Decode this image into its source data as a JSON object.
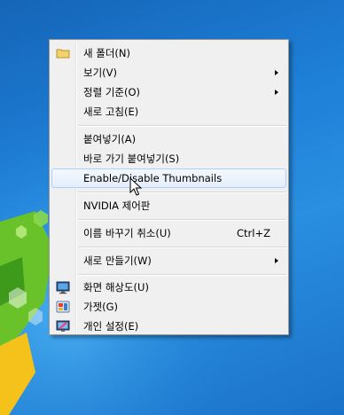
{
  "menu": {
    "items": [
      {
        "label": "새 폴더(N)"
      },
      {
        "label": "보기(V)"
      },
      {
        "label": "정렬 기준(O)"
      },
      {
        "label": "새로 고침(E)"
      },
      {
        "label": "붙여넣기(A)"
      },
      {
        "label": "바로 가기 붙여넣기(S)"
      },
      {
        "label": "Enable/Disable Thumbnails"
      },
      {
        "label": "NVIDIA 제어판"
      },
      {
        "label": "이름 바꾸기 취소(U)",
        "shortcut": "Ctrl+Z"
      },
      {
        "label": "새로 만들기(W)"
      },
      {
        "label": "화면 해상도(U)"
      },
      {
        "label": "가젯(G)"
      },
      {
        "label": "개인 설정(E)"
      }
    ]
  },
  "colors": {
    "desktop": "#1e7fd6",
    "menu_bg": "#f0f0f0",
    "highlight_border": "#aecff7"
  }
}
